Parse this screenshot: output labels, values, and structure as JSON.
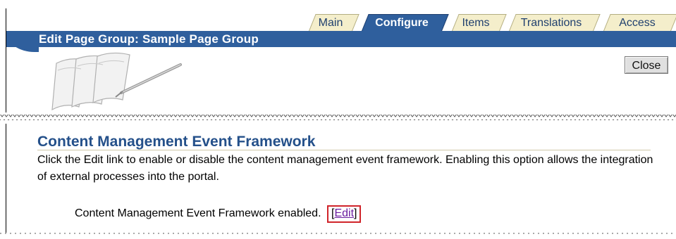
{
  "tabs": [
    {
      "label": "Main",
      "active": false
    },
    {
      "label": "Configure",
      "active": true
    },
    {
      "label": "Items",
      "active": false
    },
    {
      "label": "Translations",
      "active": false
    },
    {
      "label": "Access",
      "active": false
    }
  ],
  "header": {
    "title": "Edit Page Group: Sample Page Group"
  },
  "toolbar": {
    "close_label": "Close"
  },
  "section": {
    "title": "Content Management Event Framework",
    "description": "Click the Edit link to enable or disable the content management event framework. Enabling this option allows the integration of external processes into the portal.",
    "status_text": "Content Management Event Framework enabled.",
    "bracket_open": "[",
    "edit_label": "Edit",
    "bracket_close": "]"
  },
  "colors": {
    "accent": "#2f5f9d",
    "tab_inactive": "#f4eecb",
    "title_text": "#24508a",
    "highlight_box": "#d0242a",
    "link": "#6b1ea0"
  },
  "icons": {
    "illustration": "paper-and-pen-illustration"
  }
}
